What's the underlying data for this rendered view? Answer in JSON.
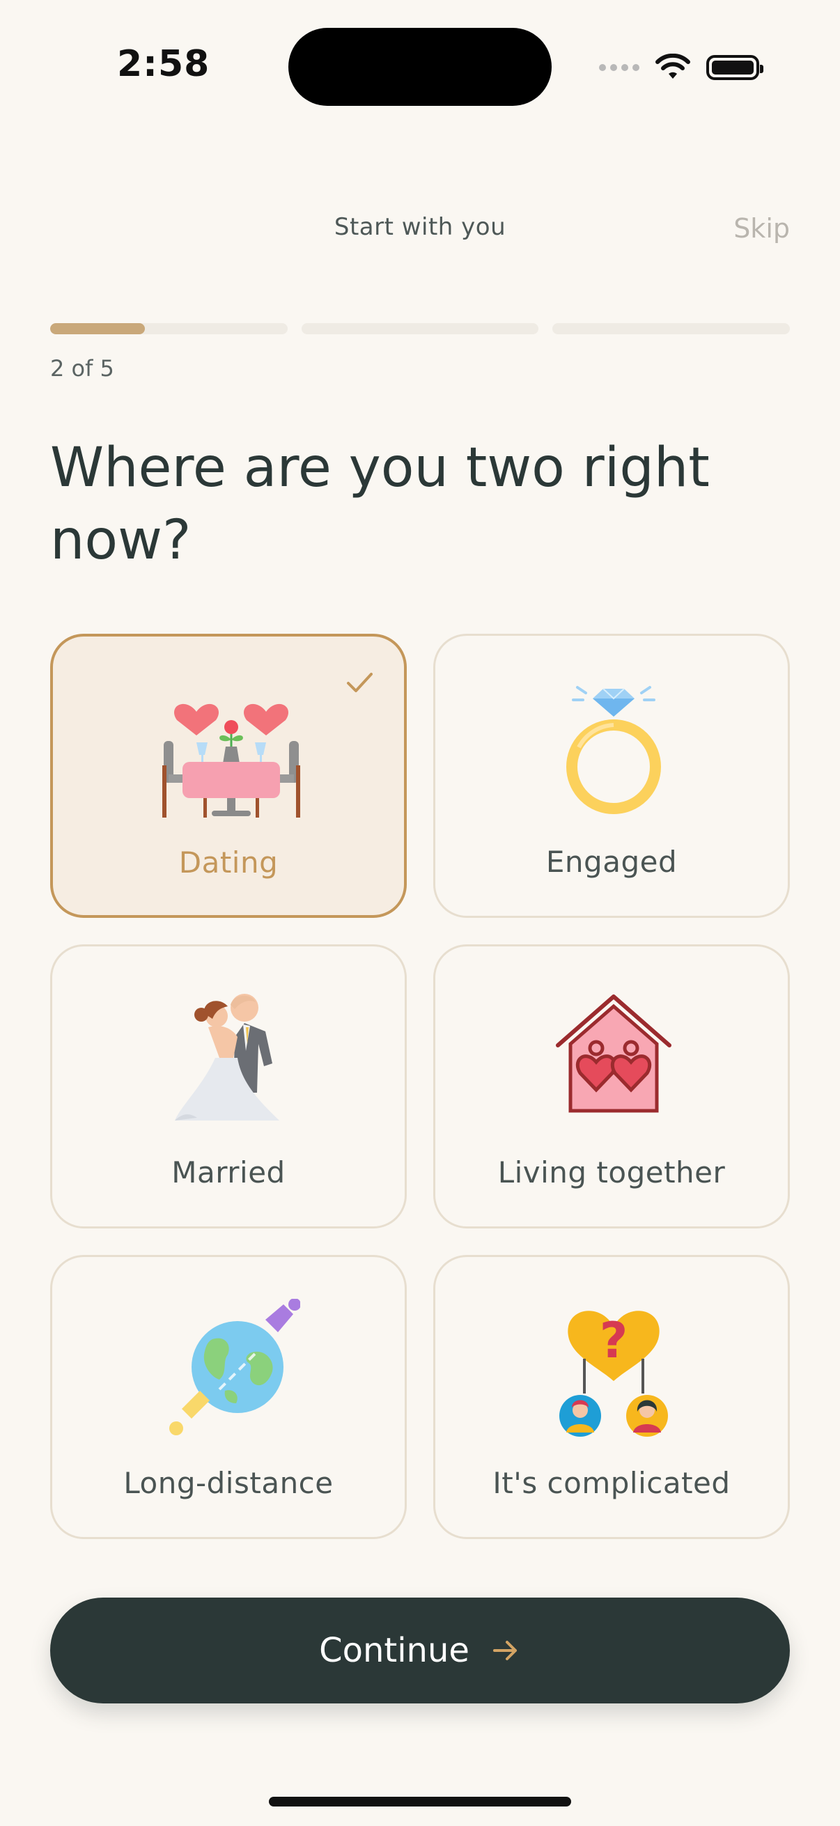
{
  "status_bar": {
    "time": "2:58"
  },
  "header": {
    "title": "Start with you",
    "skip_label": "Skip"
  },
  "progress": {
    "current_step": 2,
    "total_steps": 5,
    "label": "2 of 5",
    "segments_shown": 3,
    "first_segment_fill": 0.4,
    "fill_color": "#C9A87A"
  },
  "question": "Where are you two right now?",
  "options": [
    {
      "label": "Dating",
      "icon": "dinner-date-icon",
      "selected": true
    },
    {
      "label": "Engaged",
      "icon": "diamond-ring-icon",
      "selected": false
    },
    {
      "label": "Married",
      "icon": "wedding-couple-icon",
      "selected": false
    },
    {
      "label": "Living together",
      "icon": "house-hearts-icon",
      "selected": false
    },
    {
      "label": "Long-distance",
      "icon": "globe-plug-icon",
      "selected": false
    },
    {
      "label": "It's complicated",
      "icon": "question-heart-icon",
      "selected": false
    }
  ],
  "continue_label": "Continue",
  "colors": {
    "accent": "#C4975A",
    "dark": "#2B3837",
    "background": "#FAF7F2"
  }
}
